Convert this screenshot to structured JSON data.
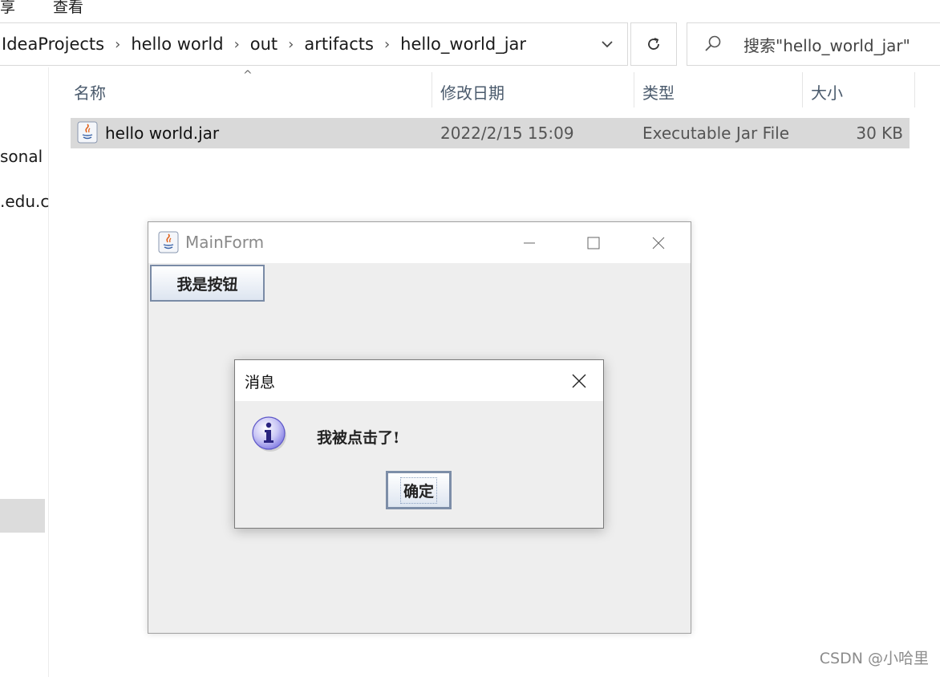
{
  "menu": {
    "share_label": "享",
    "view_label": "查看"
  },
  "address_bar": {
    "crumbs": [
      "IdeaProjects",
      "hello world",
      "out",
      "artifacts",
      "hello_world_jar"
    ],
    "separator": "›"
  },
  "search": {
    "placeholder": "搜索\"hello_world_jar\""
  },
  "nav": {
    "item_personal": "sonal",
    "item_edu": ".edu.c"
  },
  "columns": {
    "name": "名称",
    "modified": "修改日期",
    "type": "类型",
    "size": "大小"
  },
  "files": [
    {
      "name": "hello world.jar",
      "modified": "2022/2/15 15:09",
      "type": "Executable Jar File",
      "size": "30 KB"
    }
  ],
  "mainform": {
    "title": "MainForm",
    "button_label": "我是按钮"
  },
  "dialog": {
    "title": "消息",
    "message": "我被点击了!",
    "ok_label": "确定"
  },
  "watermark": "CSDN @小哈里",
  "colors": {
    "selected_row": "#d9d9d9",
    "window_bg": "#eeeeee",
    "button_border": "#7a8ba6",
    "info_icon": "#8c86e6"
  }
}
